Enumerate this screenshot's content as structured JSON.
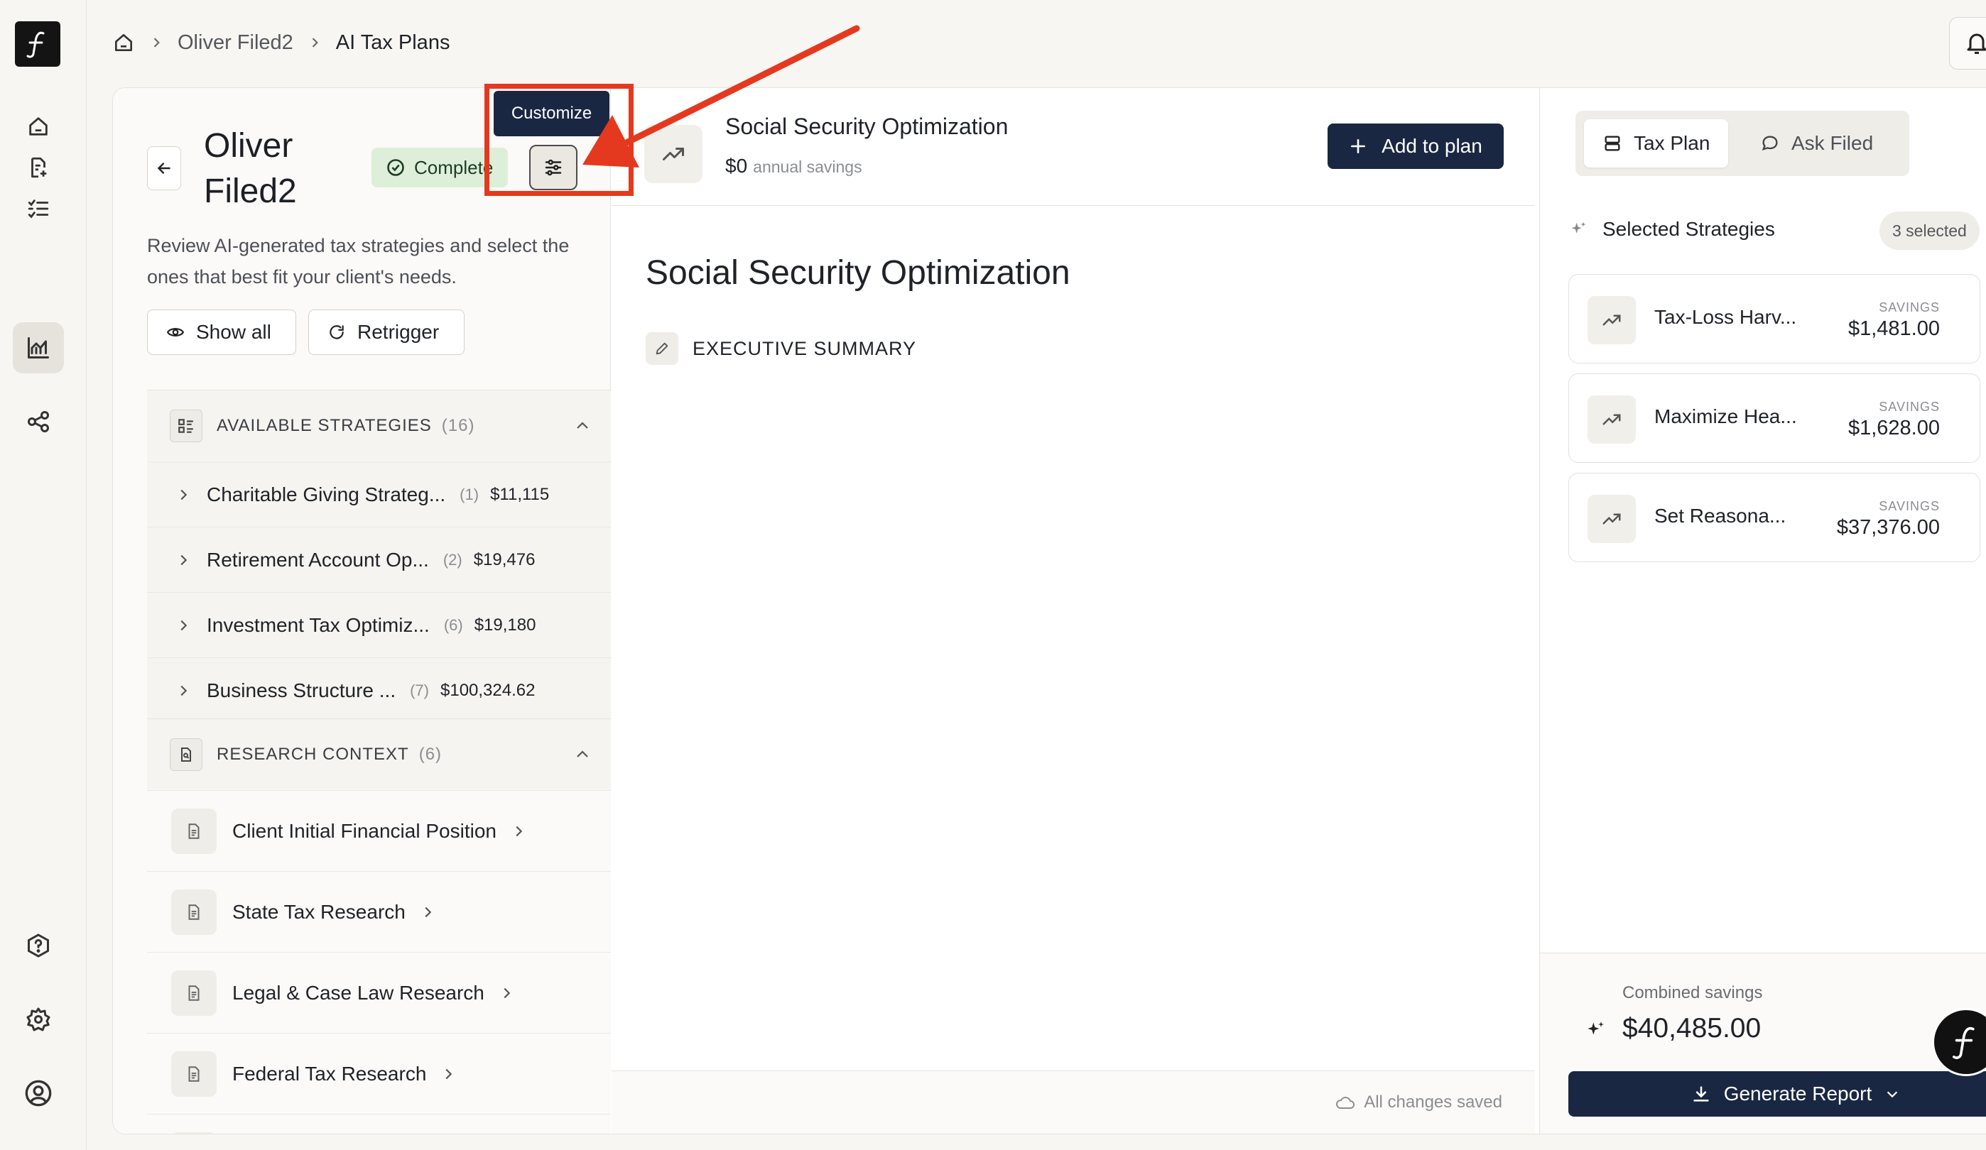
{
  "breadcrumb": {
    "client": "Oliver Filed2",
    "page": "AI Tax Plans"
  },
  "client": {
    "name": "Oliver Filed2",
    "status": "Complete"
  },
  "tooltip": "Customize",
  "description": "Review AI-generated tax strategies and select the ones that best fit your client's needs.",
  "actions": {
    "show_all": "Show all",
    "retrigger": "Retrigger"
  },
  "available": {
    "title": "AVAILABLE STRATEGIES",
    "count": "(16)",
    "items": [
      {
        "name": "Charitable Giving Strateg...",
        "count": "(1)",
        "amount": "$11,115"
      },
      {
        "name": "Retirement Account Op...",
        "count": "(2)",
        "amount": "$19,476"
      },
      {
        "name": "Investment Tax Optimiz...",
        "count": "(6)",
        "amount": "$19,180"
      },
      {
        "name": "Business Structure ...",
        "count": "(7)",
        "amount": "$100,324.62"
      }
    ]
  },
  "research": {
    "title": "RESEARCH CONTEXT",
    "count": "(6)",
    "items": [
      {
        "name": "Client Initial Financial Position"
      },
      {
        "name": "State Tax Research"
      },
      {
        "name": "Legal & Case Law Research"
      },
      {
        "name": "Federal Tax Research"
      }
    ]
  },
  "strategy": {
    "title": "Social Security Optimization",
    "savings": "$0",
    "savings_label": "annual savings",
    "add_label": "Add to plan",
    "doc_title": "Social Security Optimization",
    "section": "EXECUTIVE SUMMARY",
    "saved_status": "All changes saved"
  },
  "right": {
    "tab_plan": "Tax Plan",
    "tab_ask": "Ask Filed",
    "selected_title": "Selected Strategies",
    "selected_count": "3 selected",
    "savings_label": "SAVINGS",
    "selected": [
      {
        "name": "Tax-Loss Harv...",
        "savings": "$1,481.00"
      },
      {
        "name": "Maximize Hea...",
        "savings": "$1,628.00"
      },
      {
        "name": "Set Reasona...",
        "savings": "$37,376.00"
      }
    ],
    "combined_label": "Combined savings",
    "combined_value": "$40,485.00",
    "generate_label": "Generate Report"
  },
  "colors": {
    "navy": "#1a2743",
    "annotation": "#e5391f",
    "status_bg": "#ddefd8"
  },
  "icons": [
    "logo-icon",
    "home-icon",
    "document-icon",
    "checklist-icon",
    "chart-icon",
    "share-icon",
    "help-icon",
    "settings-icon",
    "profile-icon",
    "bell-icon",
    "arrow-left-icon",
    "check-circle-icon",
    "sliders-icon",
    "eye-icon",
    "refresh-icon",
    "chevron-up-icon",
    "chevron-right-icon",
    "trending-up-icon",
    "plus-icon",
    "pencil-icon",
    "cloud-icon",
    "list-icon",
    "chat-icon",
    "sparkles-icon",
    "download-icon",
    "chevron-down-icon"
  ]
}
